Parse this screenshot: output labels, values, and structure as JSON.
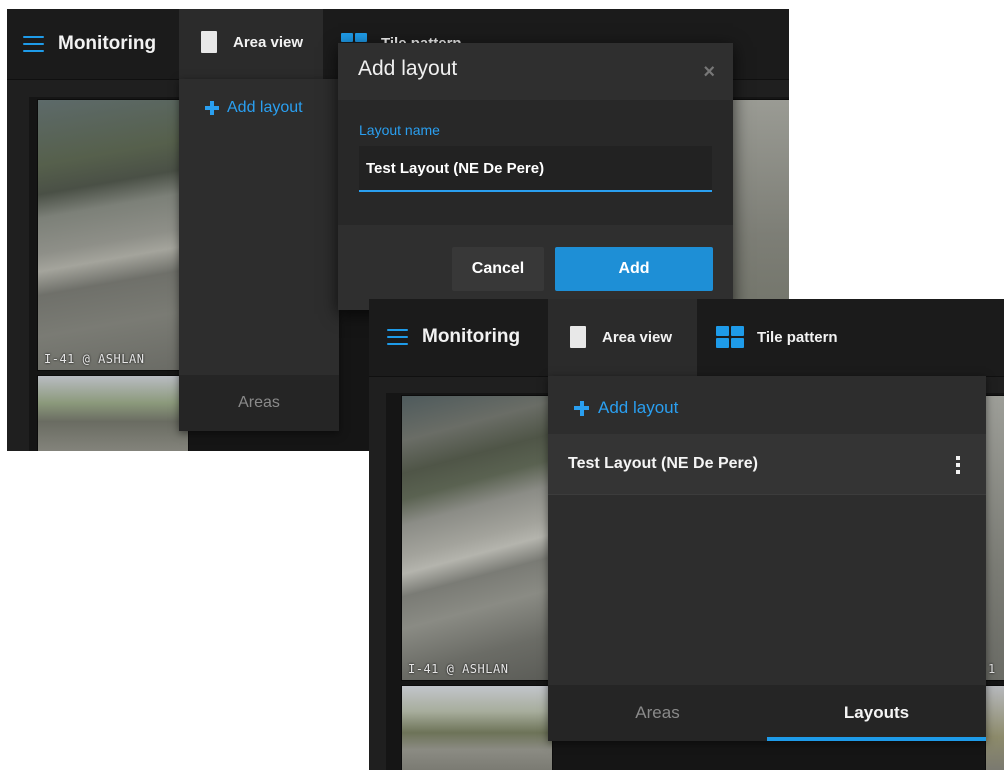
{
  "back": {
    "topbar": {
      "title": "Monitoring",
      "area_view": "Area view",
      "tile_pattern": "Tile pattern"
    },
    "panel": {
      "add_layout": "Add layout",
      "tab_areas": "Areas"
    },
    "camera_label": "I-41 @ ASHLAN"
  },
  "dialog": {
    "title": "Add layout",
    "close_glyph": "×",
    "field_label": "Layout name",
    "field_value": "Test Layout (NE De Pere)",
    "cancel": "Cancel",
    "add": "Add"
  },
  "front": {
    "topbar": {
      "title": "Monitoring",
      "area_view": "Area view",
      "tile_pattern": "Tile pattern"
    },
    "panel": {
      "add_layout": "Add layout",
      "layouts": [
        {
          "name": "Test Layout (NE De Pere)"
        }
      ],
      "tab_areas": "Areas",
      "tab_layouts": "Layouts",
      "active_tab": "Layouts"
    },
    "camera_label": "I-41 @ ASHLAN",
    "camera_label_right": "1"
  },
  "colors": {
    "accent": "#1e9be9",
    "panel": "#2d2d2d",
    "topbar": "#1b1b1b"
  }
}
